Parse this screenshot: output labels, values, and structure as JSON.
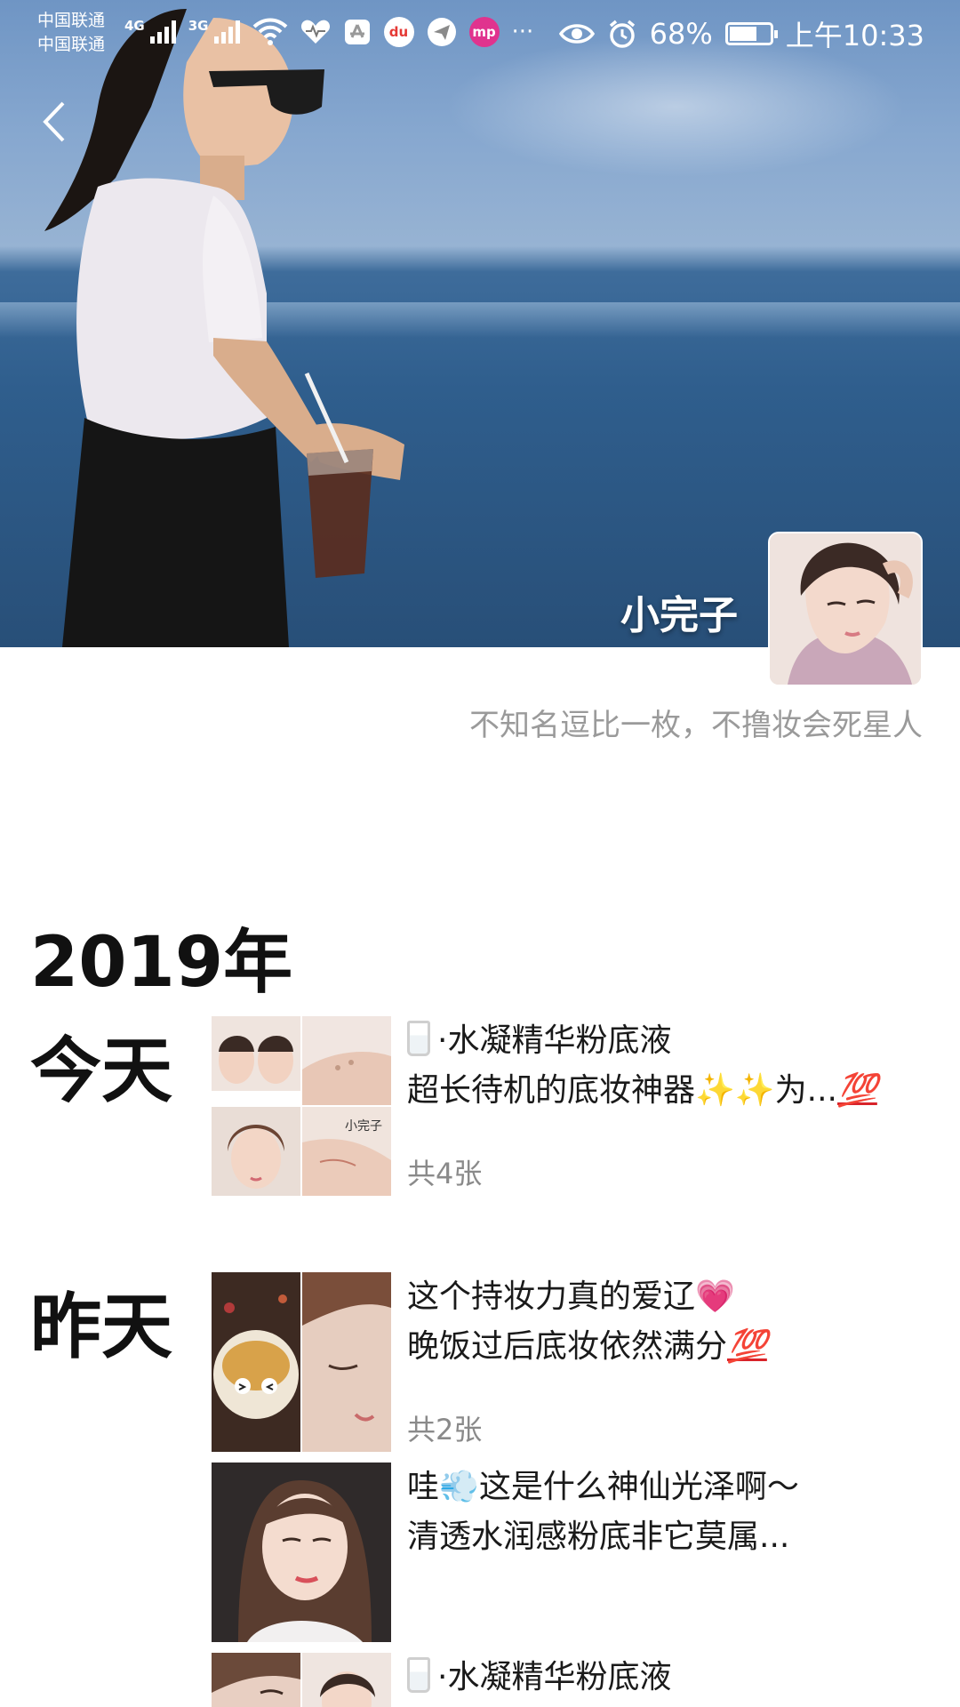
{
  "status_bar": {
    "carrier_1": "中国联通",
    "carrier_2": "中国联通",
    "net_1": "4G",
    "net_2": "3G",
    "app_icons": [
      "heart-rate-icon",
      "huawei-icon",
      "du-icon",
      "paper-plane-icon",
      "mp-icon"
    ],
    "app_du": "du",
    "app_mp": "mp",
    "more": "···",
    "battery_text": "68%",
    "battery_level": 0.68,
    "time": "上午10:33"
  },
  "profile": {
    "nickname": "小完子",
    "signature": "不知名逗比一枚，不撸妆会死星人"
  },
  "timeline": {
    "year": "2019年",
    "groups": [
      {
        "day": "今天",
        "posts": [
          {
            "line1": "·水凝精华粉底液",
            "line2_a": "超长待机的底妆神器",
            "line2_b": "✨✨",
            "line2_c": "为...",
            "line2_d": "💯",
            "count": "共4张",
            "thumb_captions": [
              "小完子"
            ]
          }
        ]
      },
      {
        "day": "昨天",
        "posts": [
          {
            "line1_a": "这个持妆力真的爱辽",
            "line1_b": "💗",
            "line2_a": "晚饭过后底妆依然满分",
            "line2_b": "💯",
            "count": "共2张"
          },
          {
            "line1_a": "哇",
            "line1_b": "💨",
            "line1_c": "这是什么神仙光泽啊～",
            "line2": "清透水润感粉底非它莫属..."
          },
          {
            "line1": "·水凝精华粉底液"
          }
        ]
      }
    ]
  },
  "colors": {
    "sky": "#86a7cf",
    "sea": "#2f5e8d",
    "muted_text": "#9a9a9a",
    "count_text": "#8a8a8a"
  }
}
